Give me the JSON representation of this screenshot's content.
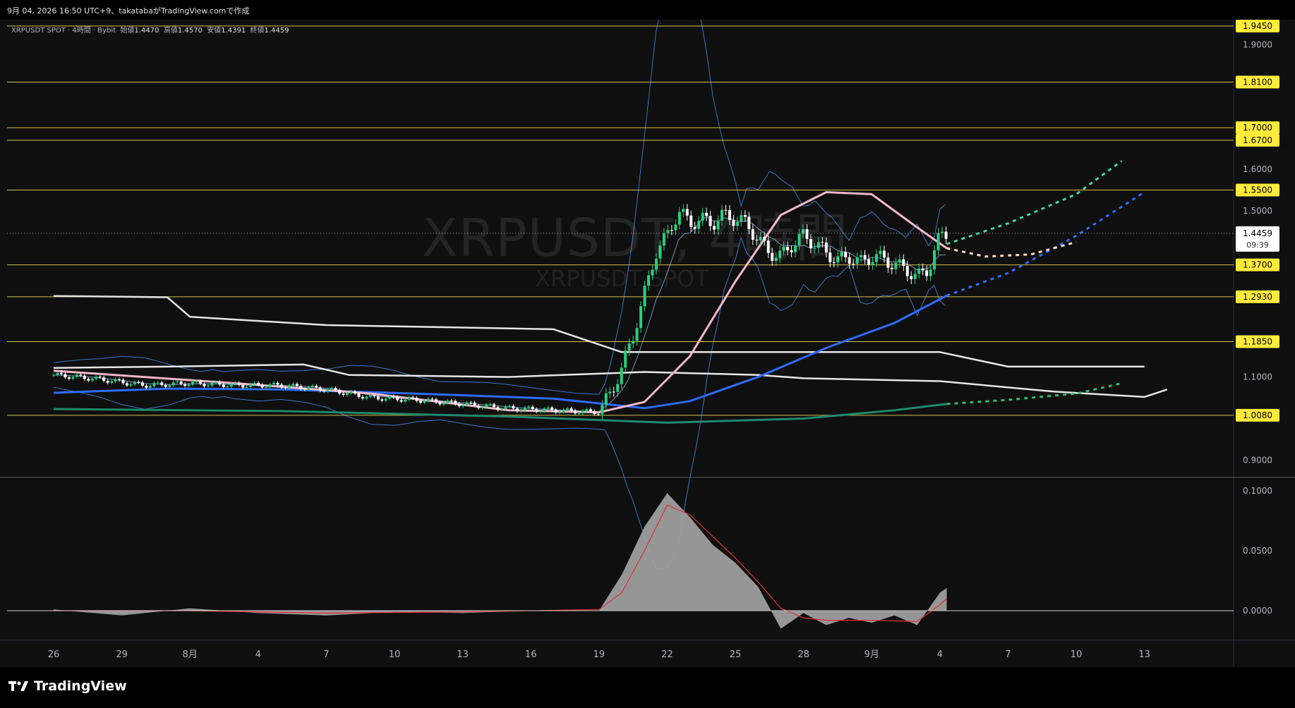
{
  "header": {
    "meta_line": "9月 04, 2026 16:50 UTC+9、takatabaがTradingView.comで作成"
  },
  "legend": {
    "symbol": "XRPUSDT SPOT · 4時間 · Bybit",
    "open_label": "始値",
    "open": "1.4470",
    "high_label": "高値",
    "high": "1.4570",
    "low_label": "安値",
    "low": "1.4391",
    "close_label": "終値",
    "close": "1.4459"
  },
  "watermark": {
    "main": "XRPUSDT, 4時間",
    "sub": "XRPUSDT SPOT"
  },
  "footer": {
    "brand": "TradingView"
  },
  "colors": {
    "background": "#0f0f0f",
    "up": "#26d07c",
    "down": "#ffffff",
    "level_line": "#f5e05a",
    "level_label_bg": "#ffeb3b",
    "sma_white": "#e6e6e6",
    "blue_ma": "#2f6bff",
    "pink_ma": "#f4b6c9",
    "teal_ma": "#1f8a6b",
    "bollinger": "#3f7fd8",
    "osc_fill": "#9e9e9e",
    "osc_signal": "#e0303a"
  },
  "chart_data": {
    "type": "line",
    "title": "XRPUSDT SPOT · 4時間 · Bybit",
    "y_axis": {
      "range": [
        0.86,
        1.96
      ],
      "ticks": [
        "1.9000",
        "1.6000",
        "1.5000",
        "0.9000",
        "1.1000"
      ],
      "current_price": "1.4459",
      "countdown": "09:39"
    },
    "x_axis": {
      "labels": [
        {
          "label": "26",
          "day": 0
        },
        {
          "label": "29",
          "day": 3
        },
        {
          "label": "8月",
          "day": 6
        },
        {
          "label": "4",
          "day": 9
        },
        {
          "label": "7",
          "day": 12
        },
        {
          "label": "10",
          "day": 15
        },
        {
          "label": "13",
          "day": 18
        },
        {
          "label": "16",
          "day": 21
        },
        {
          "label": "19",
          "day": 24
        },
        {
          "label": "22",
          "day": 27
        },
        {
          "label": "25",
          "day": 30
        },
        {
          "label": "28",
          "day": 33
        },
        {
          "label": "9月",
          "day": 36
        },
        {
          "label": "4",
          "day": 39
        },
        {
          "label": "7",
          "day": 42
        },
        {
          "label": "10",
          "day": 45
        },
        {
          "label": "13",
          "day": 48
        }
      ]
    },
    "horizontal_levels": [
      "1.9450",
      "1.8100",
      "1.7000",
      "1.6700",
      "1.5500",
      "1.3700",
      "1.2930",
      "1.1850",
      "1.0080"
    ],
    "price_path": {
      "description_days": [
        0,
        2,
        4,
        6,
        8,
        10,
        12,
        14,
        16,
        18,
        20,
        22,
        24,
        24.5,
        25,
        25.5,
        26,
        26.5,
        27,
        27.5,
        28,
        28.5,
        29,
        29.5,
        30,
        30.5,
        31,
        31.5,
        32,
        32.5,
        33,
        33.5,
        34,
        34.5,
        35,
        35.5,
        36,
        36.5,
        37,
        37.5,
        38,
        38.5,
        39,
        39.3
      ],
      "close": [
        1.105,
        1.095,
        1.08,
        1.085,
        1.08,
        1.08,
        1.07,
        1.05,
        1.045,
        1.035,
        1.025,
        1.02,
        1.015,
        1.06,
        1.12,
        1.2,
        1.3,
        1.4,
        1.44,
        1.5,
        1.47,
        1.48,
        1.47,
        1.49,
        1.48,
        1.47,
        1.43,
        1.4,
        1.39,
        1.42,
        1.44,
        1.42,
        1.4,
        1.38,
        1.39,
        1.375,
        1.39,
        1.385,
        1.37,
        1.36,
        1.34,
        1.36,
        1.44,
        1.446
      ]
    },
    "series": [
      {
        "kind": "sma_white_top",
        "points": [
          [
            0,
            1.295
          ],
          [
            5,
            1.292
          ],
          [
            6,
            1.245
          ],
          [
            12,
            1.225
          ],
          [
            22,
            1.215
          ],
          [
            25,
            1.16
          ],
          [
            39,
            1.16
          ],
          [
            42,
            1.125
          ],
          [
            48,
            1.125
          ]
        ]
      },
      {
        "kind": "sma_white_mid",
        "points": [
          [
            0,
            1.122
          ],
          [
            5,
            1.125
          ],
          [
            11,
            1.13
          ],
          [
            13,
            1.105
          ],
          [
            20,
            1.1
          ],
          [
            26,
            1.112
          ],
          [
            31,
            1.105
          ],
          [
            33,
            1.097
          ],
          [
            39,
            1.09
          ],
          [
            44,
            1.065
          ],
          [
            48,
            1.052
          ],
          [
            49,
            1.07
          ]
        ]
      },
      {
        "kind": "blue_ma",
        "points": [
          [
            0,
            1.062
          ],
          [
            5,
            1.072
          ],
          [
            10,
            1.07
          ],
          [
            16,
            1.06
          ],
          [
            22,
            1.048
          ],
          [
            26,
            1.025
          ],
          [
            28,
            1.042
          ],
          [
            31,
            1.1
          ],
          [
            34,
            1.17
          ],
          [
            37,
            1.23
          ],
          [
            39.3,
            1.296
          ]
        ]
      },
      {
        "kind": "pink_ma",
        "points": [
          [
            0,
            1.115
          ],
          [
            8,
            1.085
          ],
          [
            14,
            1.06
          ],
          [
            20,
            1.02
          ],
          [
            24,
            1.015
          ],
          [
            26,
            1.04
          ],
          [
            28,
            1.15
          ],
          [
            30,
            1.33
          ],
          [
            32,
            1.49
          ],
          [
            34,
            1.545
          ],
          [
            36,
            1.54
          ],
          [
            38,
            1.46
          ],
          [
            39.3,
            1.41
          ]
        ]
      },
      {
        "kind": "teal_ma",
        "points": [
          [
            0,
            1.023
          ],
          [
            10,
            1.018
          ],
          [
            20,
            1.005
          ],
          [
            27,
            0.99
          ],
          [
            33,
            1.0
          ],
          [
            37,
            1.02
          ],
          [
            39.3,
            1.035
          ]
        ]
      }
    ],
    "projections": [
      {
        "kind": "blue_ma",
        "points": [
          [
            39.3,
            1.296
          ],
          [
            42,
            1.35
          ],
          [
            45,
            1.44
          ],
          [
            48,
            1.545
          ]
        ]
      },
      {
        "kind": "pink_ma",
        "points": [
          [
            39.3,
            1.41
          ],
          [
            41,
            1.39
          ],
          [
            43,
            1.395
          ],
          [
            45,
            1.425
          ]
        ]
      },
      {
        "kind": "green",
        "points": [
          [
            39.3,
            1.42
          ],
          [
            42,
            1.47
          ],
          [
            45,
            1.54
          ],
          [
            47,
            1.62
          ]
        ]
      },
      {
        "kind": "teal_ma",
        "points": [
          [
            39.3,
            1.035
          ],
          [
            42,
            1.045
          ],
          [
            45,
            1.06
          ],
          [
            47,
            1.085
          ]
        ]
      }
    ],
    "oscillator": {
      "range": [
        -0.02,
        0.1
      ],
      "ticks": [
        "0.1000",
        "0.0500",
        "0.0000"
      ],
      "hist": [
        [
          0,
          0.001
        ],
        [
          3,
          -0.004
        ],
        [
          6,
          0.002
        ],
        [
          9,
          -0.002
        ],
        [
          12,
          -0.004
        ],
        [
          15,
          -0.001
        ],
        [
          18,
          -0.002
        ],
        [
          21,
          0.0
        ],
        [
          24,
          0.0
        ],
        [
          25,
          0.03
        ],
        [
          26,
          0.07
        ],
        [
          27,
          0.098
        ],
        [
          28,
          0.078
        ],
        [
          29,
          0.055
        ],
        [
          30,
          0.04
        ],
        [
          31,
          0.02
        ],
        [
          32,
          -0.015
        ],
        [
          33,
          -0.002
        ],
        [
          34,
          -0.012
        ],
        [
          35,
          -0.006
        ],
        [
          36,
          -0.01
        ],
        [
          37,
          -0.004
        ],
        [
          38,
          -0.012
        ],
        [
          39,
          0.015
        ],
        [
          39.3,
          0.019
        ]
      ],
      "signal": [
        [
          0,
          0.0
        ],
        [
          6,
          0.0
        ],
        [
          12,
          -0.002
        ],
        [
          18,
          -0.001
        ],
        [
          24,
          0.001
        ],
        [
          25,
          0.015
        ],
        [
          26,
          0.05
        ],
        [
          27,
          0.088
        ],
        [
          28,
          0.08
        ],
        [
          29,
          0.062
        ],
        [
          30,
          0.044
        ],
        [
          31,
          0.024
        ],
        [
          32,
          0.002
        ],
        [
          33,
          -0.006
        ],
        [
          34,
          -0.008
        ],
        [
          36,
          -0.008
        ],
        [
          38,
          -0.009
        ],
        [
          39,
          0.005
        ],
        [
          39.3,
          0.01
        ]
      ]
    }
  }
}
